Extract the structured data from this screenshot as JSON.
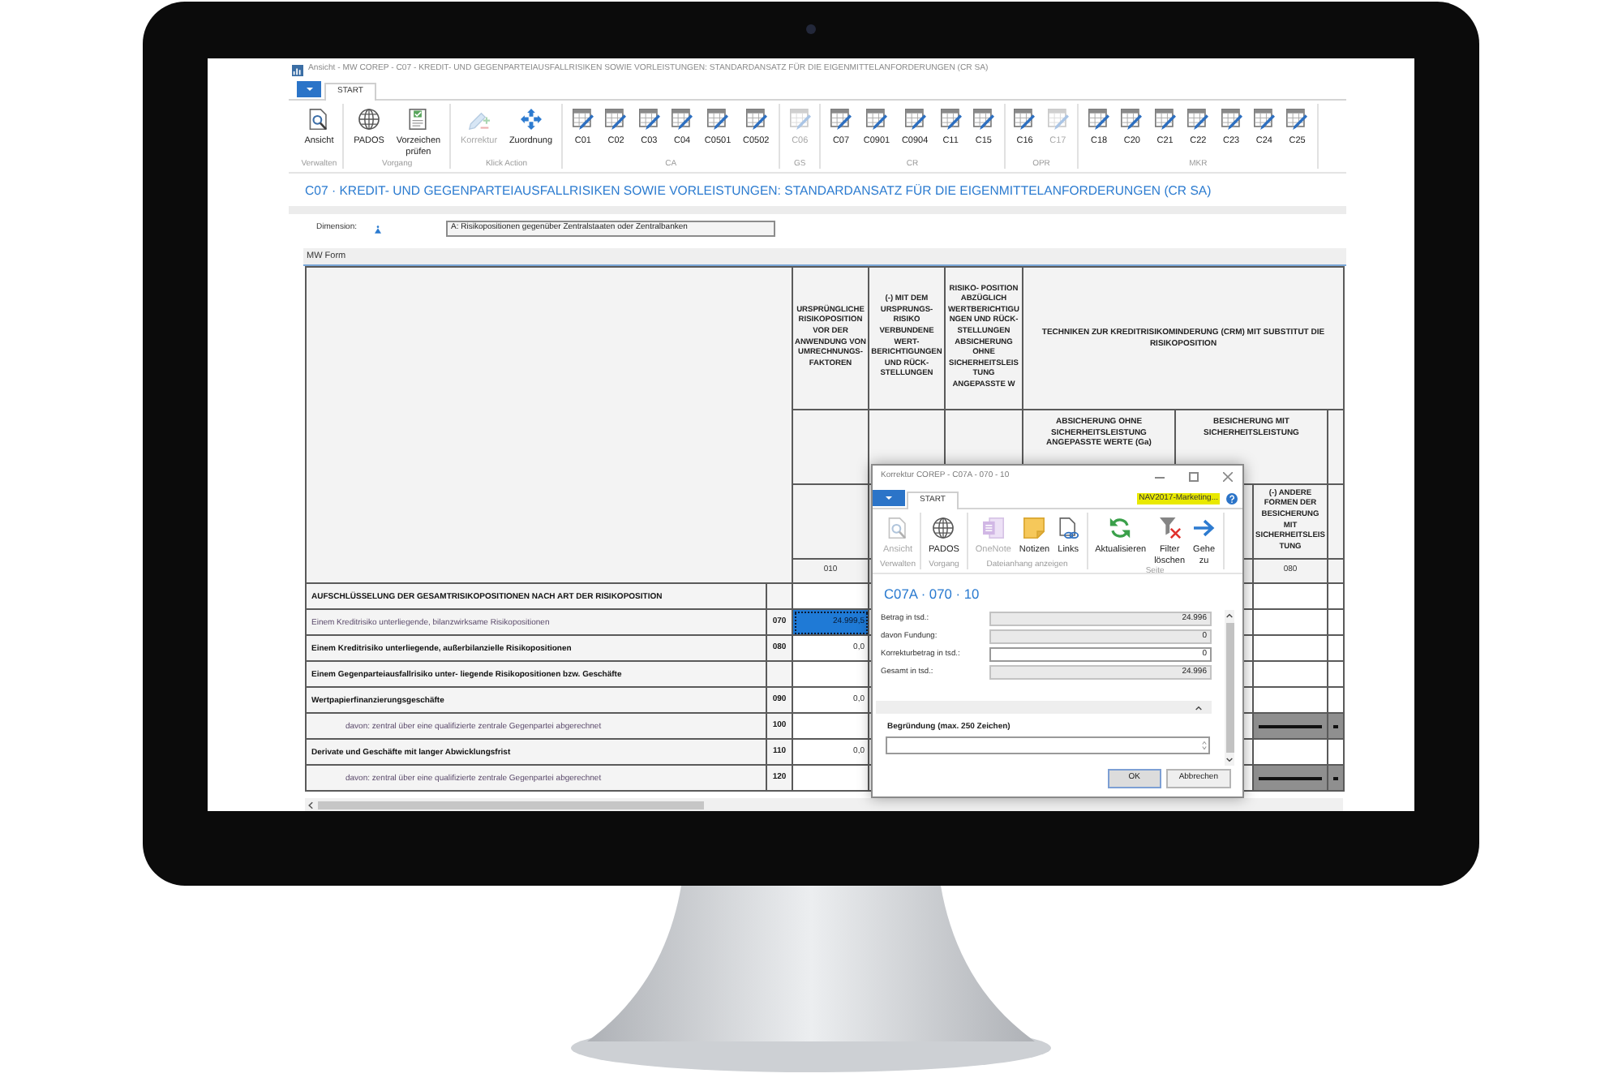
{
  "window": {
    "title": "Ansicht - MW COREP - C07 - KREDIT- UND GEGENPARTEIAUSFALLRISIKEN SOWIE VORLEISTUNGEN: STANDARDANSATZ FÜR DIE EIGENMITTELANFORDERUNGEN (CR SA)"
  },
  "ribbon": {
    "tabs": [
      {
        "label": "START",
        "selected": true
      }
    ],
    "groups": [
      {
        "label": "Verwalten",
        "buttons": [
          {
            "label": "Ansicht",
            "kind": "view",
            "disabled": false
          }
        ]
      },
      {
        "label": "Vorgang",
        "buttons": [
          {
            "label": "PADOS",
            "kind": "globe",
            "disabled": false
          },
          {
            "label": "Vorzeichen prüfen",
            "kind": "checklist",
            "disabled": false
          }
        ]
      },
      {
        "label": "Klick Action",
        "buttons": [
          {
            "label": "Korrektur",
            "kind": "correction",
            "disabled": true
          },
          {
            "label": "Zuordnung",
            "kind": "assign",
            "disabled": false
          }
        ]
      },
      {
        "label": "CA",
        "buttons": [
          {
            "label": "C01",
            "kind": "table",
            "disabled": false
          },
          {
            "label": "C02",
            "kind": "table",
            "disabled": false
          },
          {
            "label": "C03",
            "kind": "table",
            "disabled": false
          },
          {
            "label": "C04",
            "kind": "table",
            "disabled": false
          },
          {
            "label": "C0501",
            "kind": "table",
            "disabled": false
          },
          {
            "label": "C0502",
            "kind": "table",
            "disabled": false
          }
        ]
      },
      {
        "label": "GS",
        "buttons": [
          {
            "label": "C06",
            "kind": "table",
            "disabled": true
          }
        ]
      },
      {
        "label": "CR",
        "buttons": [
          {
            "label": "C07",
            "kind": "table",
            "disabled": false
          },
          {
            "label": "C0901",
            "kind": "table",
            "disabled": false
          },
          {
            "label": "C0904",
            "kind": "table",
            "disabled": false
          },
          {
            "label": "C11",
            "kind": "table",
            "disabled": false
          },
          {
            "label": "C15",
            "kind": "table",
            "disabled": false
          }
        ]
      },
      {
        "label": "OPR",
        "buttons": [
          {
            "label": "C16",
            "kind": "table",
            "disabled": false
          },
          {
            "label": "C17",
            "kind": "table",
            "disabled": true
          }
        ]
      },
      {
        "label": "MKR",
        "buttons": [
          {
            "label": "C18",
            "kind": "table",
            "disabled": false
          },
          {
            "label": "C20",
            "kind": "table",
            "disabled": false
          },
          {
            "label": "C21",
            "kind": "table",
            "disabled": false
          },
          {
            "label": "C22",
            "kind": "table",
            "disabled": false
          },
          {
            "label": "C23",
            "kind": "table",
            "disabled": false
          },
          {
            "label": "C24",
            "kind": "table",
            "disabled": false
          },
          {
            "label": "C25",
            "kind": "table",
            "disabled": false
          }
        ]
      }
    ]
  },
  "heading": "C07 · KREDIT- UND GEGENPARTEIAUSFALLRISIKEN SOWIE VORLEISTUNGEN: STANDARDANSATZ FÜR DIE EIGENMITTELANFORDERUNGEN (CR SA)",
  "dimension": {
    "label": "Dimension:",
    "value": "A: Risikopositionen gegenüber Zentralstaaten oder Zentralbanken"
  },
  "table": {
    "caption": "MW Form",
    "header": {
      "columns": [
        {
          "label": "URSPRÜNGLICHE RISIKOPOSITION VOR DER ANWENDUNG VON UMRECHNUNGS- FAKTOREN",
          "code": "010"
        },
        {
          "label": "(-) MIT DEM URSPRUNGS- RISIKO VERBUNDENE WERT- BERICHTIGUNGEN UND RÜCK- STELLUNGEN"
        },
        {
          "label": "RISIKO- POSITION ABZÜGLICH WERTBERICHTIGUNGEN UND RÜCK- STELLUNGEN ABSICHERUNG OHNE SICHERHEITSLEISTUNG ANGEPASSTE W"
        }
      ],
      "group": {
        "label": "TECHNIKEN ZUR KREDITRISIKOMINDERUNG (CRM) MIT SUBSTITUT DIE RISIKOPOSITION",
        "subgroups": [
          {
            "label": "ABSICHERUNG OHNE SICHERHEITSLEISTUNG ANGEPASSTE WERTE (Ga)"
          },
          {
            "label": "BESICHERUNG MIT SICHERHEITSLEISTUNG",
            "columns": [
              {
                "label": "(-) ANDERE FORMEN DER BESICHERUNG MIT SICHERHEITSLEISTUNG",
                "code": "080"
              }
            ]
          }
        ]
      }
    },
    "rows": [
      {
        "label": "AUFSCHLÜSSELUNG DER GESAMTRISIKOPOSITIONEN NACH ART DER RISIKOPOSITION",
        "bold": true,
        "selected": false,
        "shaded": false
      },
      {
        "label": "Einem Kreditrisiko unterliegende, bilanzwirksame Risikopositionen",
        "bold": false,
        "code": "070",
        "value": "24.999,5",
        "selected": true,
        "shaded": false
      },
      {
        "label": "Einem Kreditrisiko unterliegende, außerbilanzielle Risikopositionen",
        "bold": true,
        "code": "080",
        "value": "0,0",
        "selected": false,
        "shaded": false
      },
      {
        "label": "Einem Gegenparteiausfallrisiko unter- liegende Risikopositionen bzw. Geschäfte",
        "bold": true,
        "selected": false,
        "shaded": false
      },
      {
        "label": "Wertpapierfinanzierungsgeschäfte",
        "bold": true,
        "code": "090",
        "value": "0,0",
        "selected": false,
        "shaded": false,
        "children": [
          {
            "label": "davon: zentral über eine qualifizierte zentrale Gegenpartei abgerechnet",
            "bold": false,
            "code": "100",
            "selected": false,
            "shaded": true
          }
        ]
      },
      {
        "label": "Derivate und Geschäfte mit langer Abwicklungsfrist",
        "bold": true,
        "code": "110",
        "value": "0,0",
        "selected": false,
        "shaded": false,
        "children": [
          {
            "label": "davon: zentral über eine qualifizierte zentrale Gegenpartei abgerechnet",
            "bold": false,
            "code": "120",
            "selected": false,
            "shaded": true
          }
        ]
      }
    ]
  },
  "dialog": {
    "title": "Korrektur COREP - C07A - 070 - 10",
    "tabs": [
      {
        "label": "START",
        "selected": true
      }
    ],
    "company": "NAV2017-Marketing...",
    "groups": [
      {
        "label": "Verwalten",
        "buttons": [
          {
            "label": "Ansicht",
            "kind": "view",
            "disabled": true
          }
        ]
      },
      {
        "label": "Vorgang",
        "buttons": [
          {
            "label": "PADOS",
            "kind": "globe",
            "disabled": false
          }
        ]
      },
      {
        "label": "Dateianhang anzeigen",
        "buttons": [
          {
            "label": "OneNote",
            "kind": "onenote",
            "disabled": true
          },
          {
            "label": "Notizen",
            "kind": "note",
            "disabled": false
          },
          {
            "label": "Links",
            "kind": "link",
            "disabled": false
          }
        ]
      },
      {
        "label": "Seite",
        "buttons": [
          {
            "label": "Aktualisieren",
            "kind": "refresh",
            "disabled": false
          },
          {
            "label": "Filter löschen",
            "kind": "filter-clear",
            "disabled": false
          },
          {
            "label": "Gehe zu",
            "kind": "goto",
            "disabled": false
          }
        ]
      }
    ],
    "heading": "C07A · 070 · 10",
    "fields": [
      {
        "label": "Betrag in tsd.:",
        "value": "24.996",
        "editable": false
      },
      {
        "label": "davon Fundung:",
        "value": "0",
        "editable": false
      },
      {
        "label": "Korrekturbetrag in tsd.:",
        "value": "0",
        "editable": true
      },
      {
        "label": "Gesamt in tsd.:",
        "value": "24.996",
        "editable": false
      }
    ],
    "note": {
      "label": "Begründung (max. 250 Zeichen)",
      "expanded": true
    },
    "buttons": [
      {
        "label": "OK",
        "default": true
      },
      {
        "label": "Abbrechen",
        "default": false
      }
    ]
  }
}
